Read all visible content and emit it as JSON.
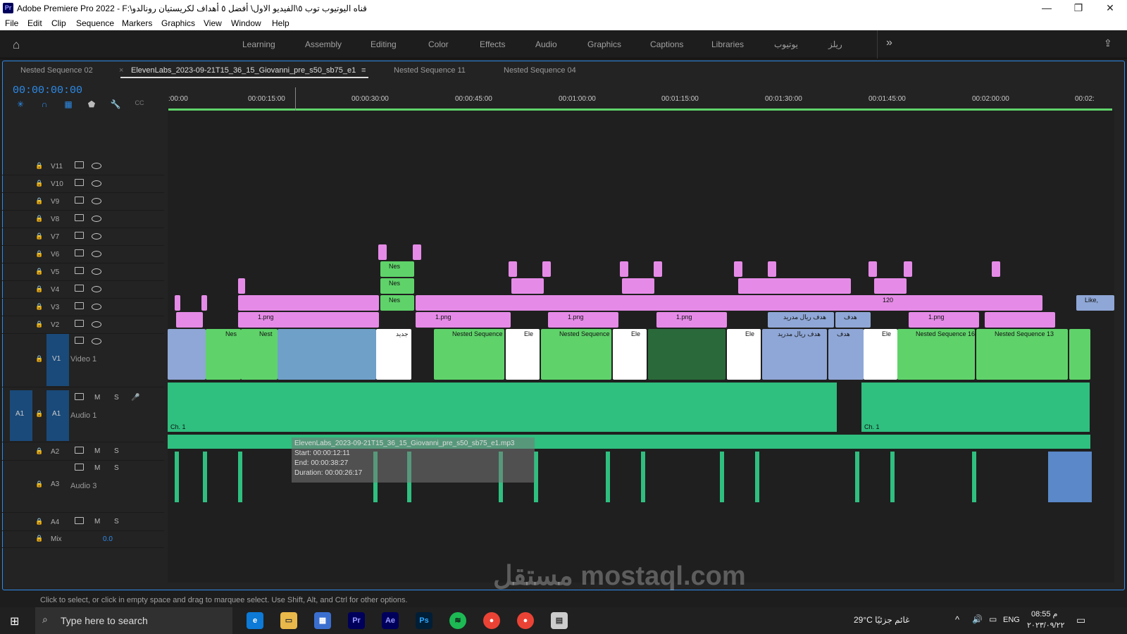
{
  "window": {
    "title": "Adobe Premiere Pro 2022 - F:\\قناه اليوتيوب توب ٥\\الفيديو الاول\\ أفضل ٥ أهداف لكريستيان رونالدو",
    "logo": "Pr"
  },
  "menu": [
    "File",
    "Edit",
    "Clip",
    "Sequence",
    "Markers",
    "Graphics",
    "View",
    "Window",
    "Help"
  ],
  "workspaces": [
    "Learning",
    "Assembly",
    "Editing",
    "Color",
    "Effects",
    "Audio",
    "Graphics",
    "Captions",
    "Libraries",
    "يوتيوب",
    "ريلز"
  ],
  "tabs": [
    "Nested Sequence 02",
    "ElevenLabs_2023-09-21T15_36_15_Giovanni_pre_s50_sb75_e1",
    "Nested Sequence 11",
    "Nested Sequence 04"
  ],
  "active_tab_close": "×",
  "timecode": "00:00:00:00",
  "ruler_ticks": [
    ":00:00",
    "00:00:15:00",
    "00:00:30:00",
    "00:00:45:00",
    "00:01:00:00",
    "00:01:15:00",
    "00:01:30:00",
    "00:01:45:00",
    "00:02:00:00",
    "00:02:"
  ],
  "video_tracks": [
    "V11",
    "V10",
    "V9",
    "V8",
    "V7",
    "V6",
    "V5",
    "V4",
    "V3",
    "V2",
    "V1"
  ],
  "v1_label": "Video 1",
  "audio_tracks": [
    {
      "id": "A1",
      "name": "Audio 1"
    },
    {
      "id": "A2",
      "name": ""
    },
    {
      "id": "A3",
      "name": "Audio 3"
    },
    {
      "id": "A4",
      "name": ""
    }
  ],
  "source_patch": "A1",
  "ms_m": "M",
  "ms_s": "S",
  "mix": {
    "label": "Mix",
    "value": "0.0"
  },
  "clips": {
    "png": "1.png",
    "nested": "Nested Sequence",
    "ns16": "Nested Sequence 16",
    "ns13": "Nested Sequence 13",
    "nes": "Nes",
    "nest": "Nest",
    "ele": "Ele",
    "arabic1": "هدف ريال مدريد",
    "arabic2": "هدف",
    "jadid": "جديد",
    "n120": "120",
    "like": "Like,"
  },
  "audio_clip_label": "Ch. 1",
  "tooltip": {
    "name": "ElevenLabs_2023-09-21T15_36_15_Giovanni_pre_s50_sb75_e1.mp3",
    "start": "Start: 00:00:12:11",
    "end": "End: 00:00:38:27",
    "duration": "Duration: 00:00:26:17"
  },
  "status": "Click to select, or click in empty space and drag to marquee select. Use Shift, Alt, and Ctrl for other options.",
  "taskbar": {
    "search": "Type here to search",
    "weather": "29°C  غائم جزئيًا",
    "lang": "ENG",
    "time": "08:55 م",
    "date": "٢٠٢٣/٠٩/٢٢"
  },
  "watermark": "مستقل mostaql.com"
}
